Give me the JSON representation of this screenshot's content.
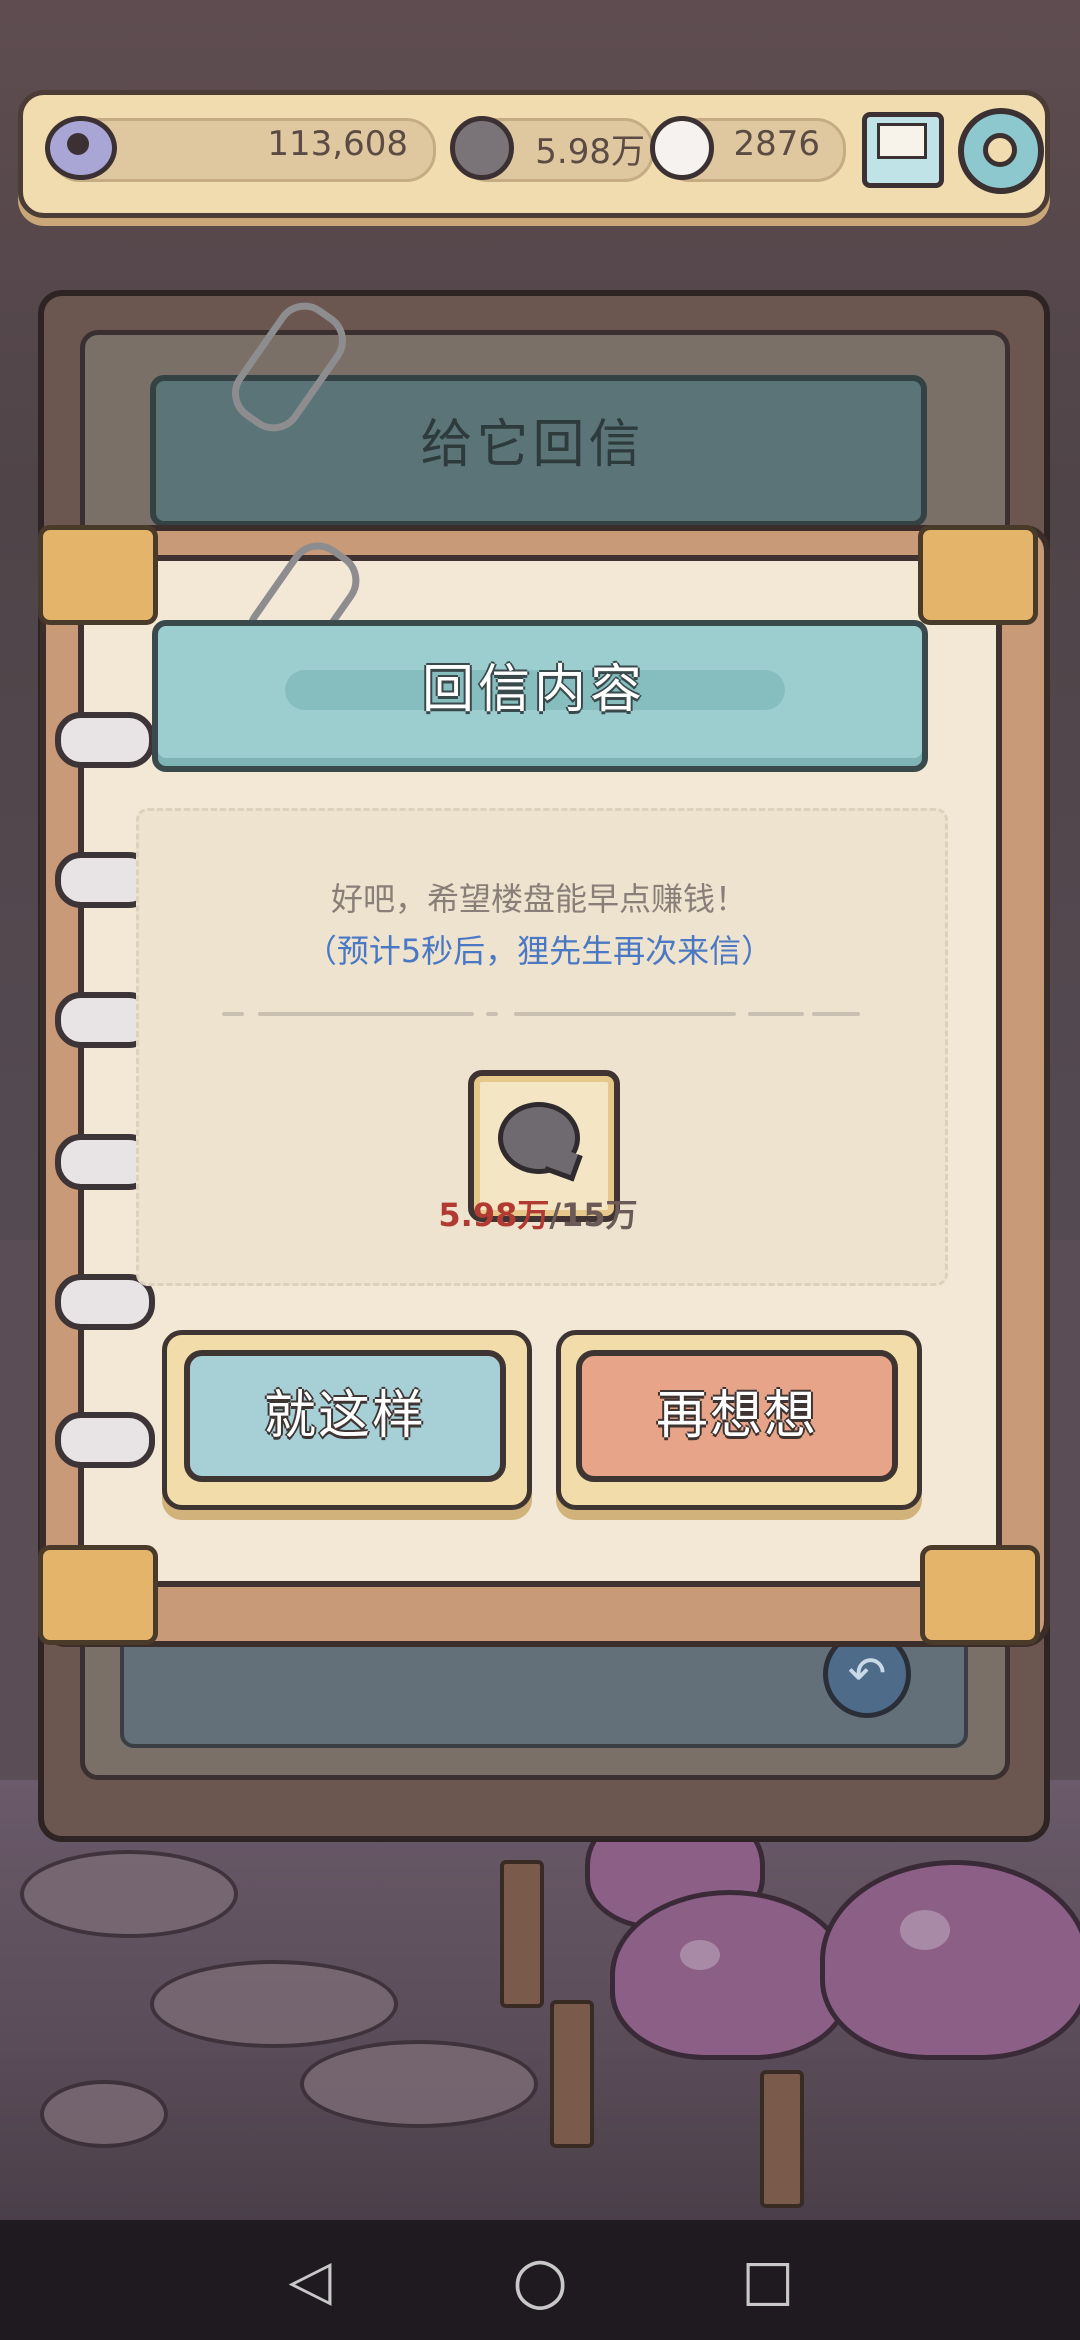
{
  "status_bar": {
    "views": "113,608",
    "coins": "5.98万",
    "messages": "2876"
  },
  "back_panel": {
    "title": "给它回信"
  },
  "dialog": {
    "title": "回信内容",
    "message": "好吧，希望楼盘能早点赚钱！",
    "note": "（预计5秒后，狸先生再次来信）",
    "reward": {
      "current": "5.98万",
      "separator": "/",
      "required": "15万"
    },
    "confirm_label": "就这样",
    "rethink_label": "再想想"
  },
  "colors": {
    "note_blue": "#4a78c4",
    "reward_current": "#b13a32",
    "reward_required": "#6b5a56",
    "confirm_button": "#a6d0d6",
    "rethink_button": "#e8a489"
  },
  "nav": {
    "back_icon": "◁",
    "home_icon": "○",
    "recent_icon": "□"
  }
}
